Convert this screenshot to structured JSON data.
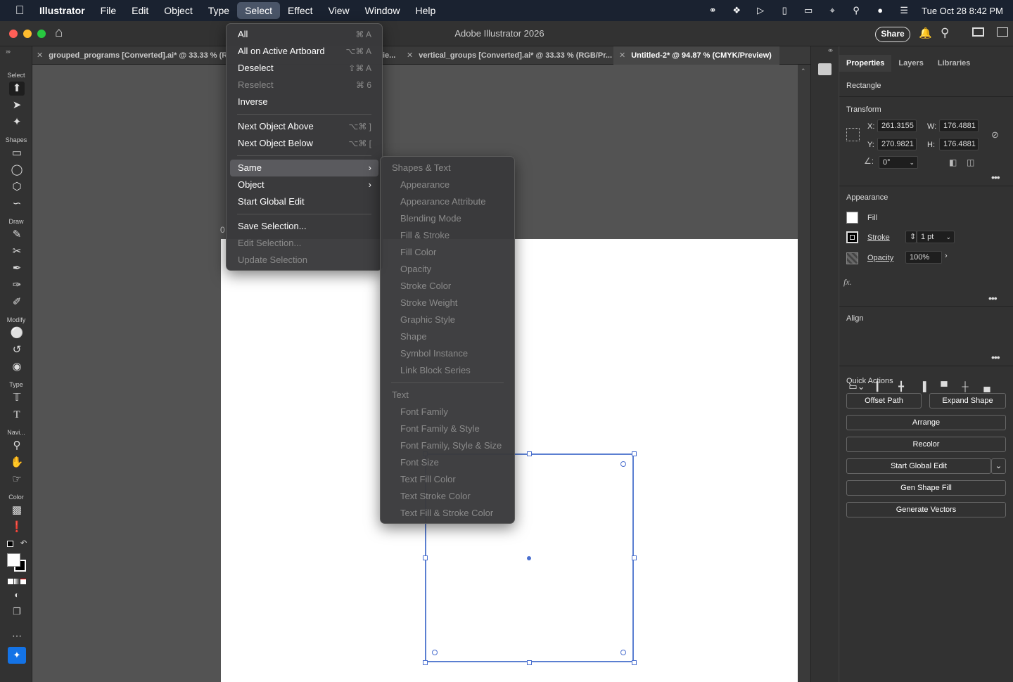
{
  "menubar": {
    "app": "Illustrator",
    "items": [
      "File",
      "Edit",
      "Object",
      "Type",
      "Select",
      "Effect",
      "View",
      "Window",
      "Help"
    ],
    "active": "Select",
    "clock": "Tue Oct 28  8:42 PM"
  },
  "window": {
    "title": "Adobe Illustrator 2026",
    "share_label": "Share"
  },
  "tabs": [
    {
      "label": "grouped_programs [Converted].ai* @ 33.33 % (RG"
    },
    {
      "label": "ie..."
    },
    {
      "label": "vertical_groups [Converted].ai* @ 33.33 % (RGB/Pr..."
    },
    {
      "label": "Untitled-2* @ 94.87 % (CMYK/Preview)"
    }
  ],
  "toolbar": {
    "sections": {
      "select": "Select",
      "shapes": "Shapes",
      "draw": "Draw",
      "modify": "Modify",
      "type": "Type",
      "navigate": "Navi...",
      "color": "Color"
    }
  },
  "canvas": {
    "ruler_mark": "0"
  },
  "select_menu": {
    "items": [
      {
        "label": "All",
        "shortcut": "⌘ A",
        "disabled": false
      },
      {
        "label": "All on Active Artboard",
        "shortcut": "⌥⌘ A",
        "disabled": false
      },
      {
        "label": "Deselect",
        "shortcut": "⇧⌘ A",
        "disabled": false
      },
      {
        "label": "Reselect",
        "shortcut": "⌘ 6",
        "disabled": true
      },
      {
        "label": "Inverse",
        "shortcut": "",
        "disabled": false
      },
      {
        "label": "Next Object Above",
        "shortcut": "⌥⌘ ]",
        "disabled": false
      },
      {
        "label": "Next Object Below",
        "shortcut": "⌥⌘ [",
        "disabled": false
      },
      {
        "label": "Same",
        "shortcut": "",
        "disabled": false
      },
      {
        "label": "Object",
        "shortcut": "",
        "disabled": false
      },
      {
        "label": "Start Global Edit",
        "shortcut": "",
        "disabled": false
      },
      {
        "label": "Save Selection...",
        "shortcut": "",
        "disabled": false
      },
      {
        "label": "Edit Selection...",
        "shortcut": "",
        "disabled": true
      },
      {
        "label": "Update Selection",
        "shortcut": "",
        "disabled": true
      }
    ]
  },
  "same_menu": {
    "header_shapes": "Shapes & Text",
    "shape_items": [
      "Appearance",
      "Appearance Attribute",
      "Blending Mode",
      "Fill & Stroke",
      "Fill Color",
      "Opacity",
      "Stroke Color",
      "Stroke Weight",
      "Graphic Style",
      "Shape",
      "Symbol Instance",
      "Link Block Series"
    ],
    "header_text": "Text",
    "text_items": [
      "Font Family",
      "Font Family & Style",
      "Font Family, Style & Size",
      "Font Size",
      "Text Fill Color",
      "Text Stroke Color",
      "Text Fill & Stroke Color"
    ]
  },
  "properties": {
    "tabs": [
      "Properties",
      "Layers",
      "Libraries"
    ],
    "object_type": "Rectangle",
    "transform": {
      "title": "Transform",
      "x_label": "X:",
      "x": "261.3155",
      "y_label": "Y:",
      "y": "270.9821",
      "w_label": "W:",
      "w": "176.4881",
      "h_label": "H:",
      "h": "176.4881",
      "angle": "0°"
    },
    "appearance": {
      "title": "Appearance",
      "fill_label": "Fill",
      "stroke_label": "Stroke",
      "stroke_value": "1 pt",
      "opacity_label": "Opacity",
      "opacity_value": "100%",
      "fx": "fx."
    },
    "align": {
      "title": "Align"
    },
    "quick_actions": {
      "title": "Quick Actions",
      "offset_path": "Offset Path",
      "expand_shape": "Expand Shape",
      "arrange": "Arrange",
      "recolor": "Recolor",
      "start_global_edit": "Start Global Edit",
      "gen_shape_fill": "Gen Shape Fill",
      "generate_vectors": "Generate Vectors"
    }
  },
  "colors": {
    "accent": "#5b7fd1",
    "panel": "#323232",
    "canvas": "#535353"
  }
}
